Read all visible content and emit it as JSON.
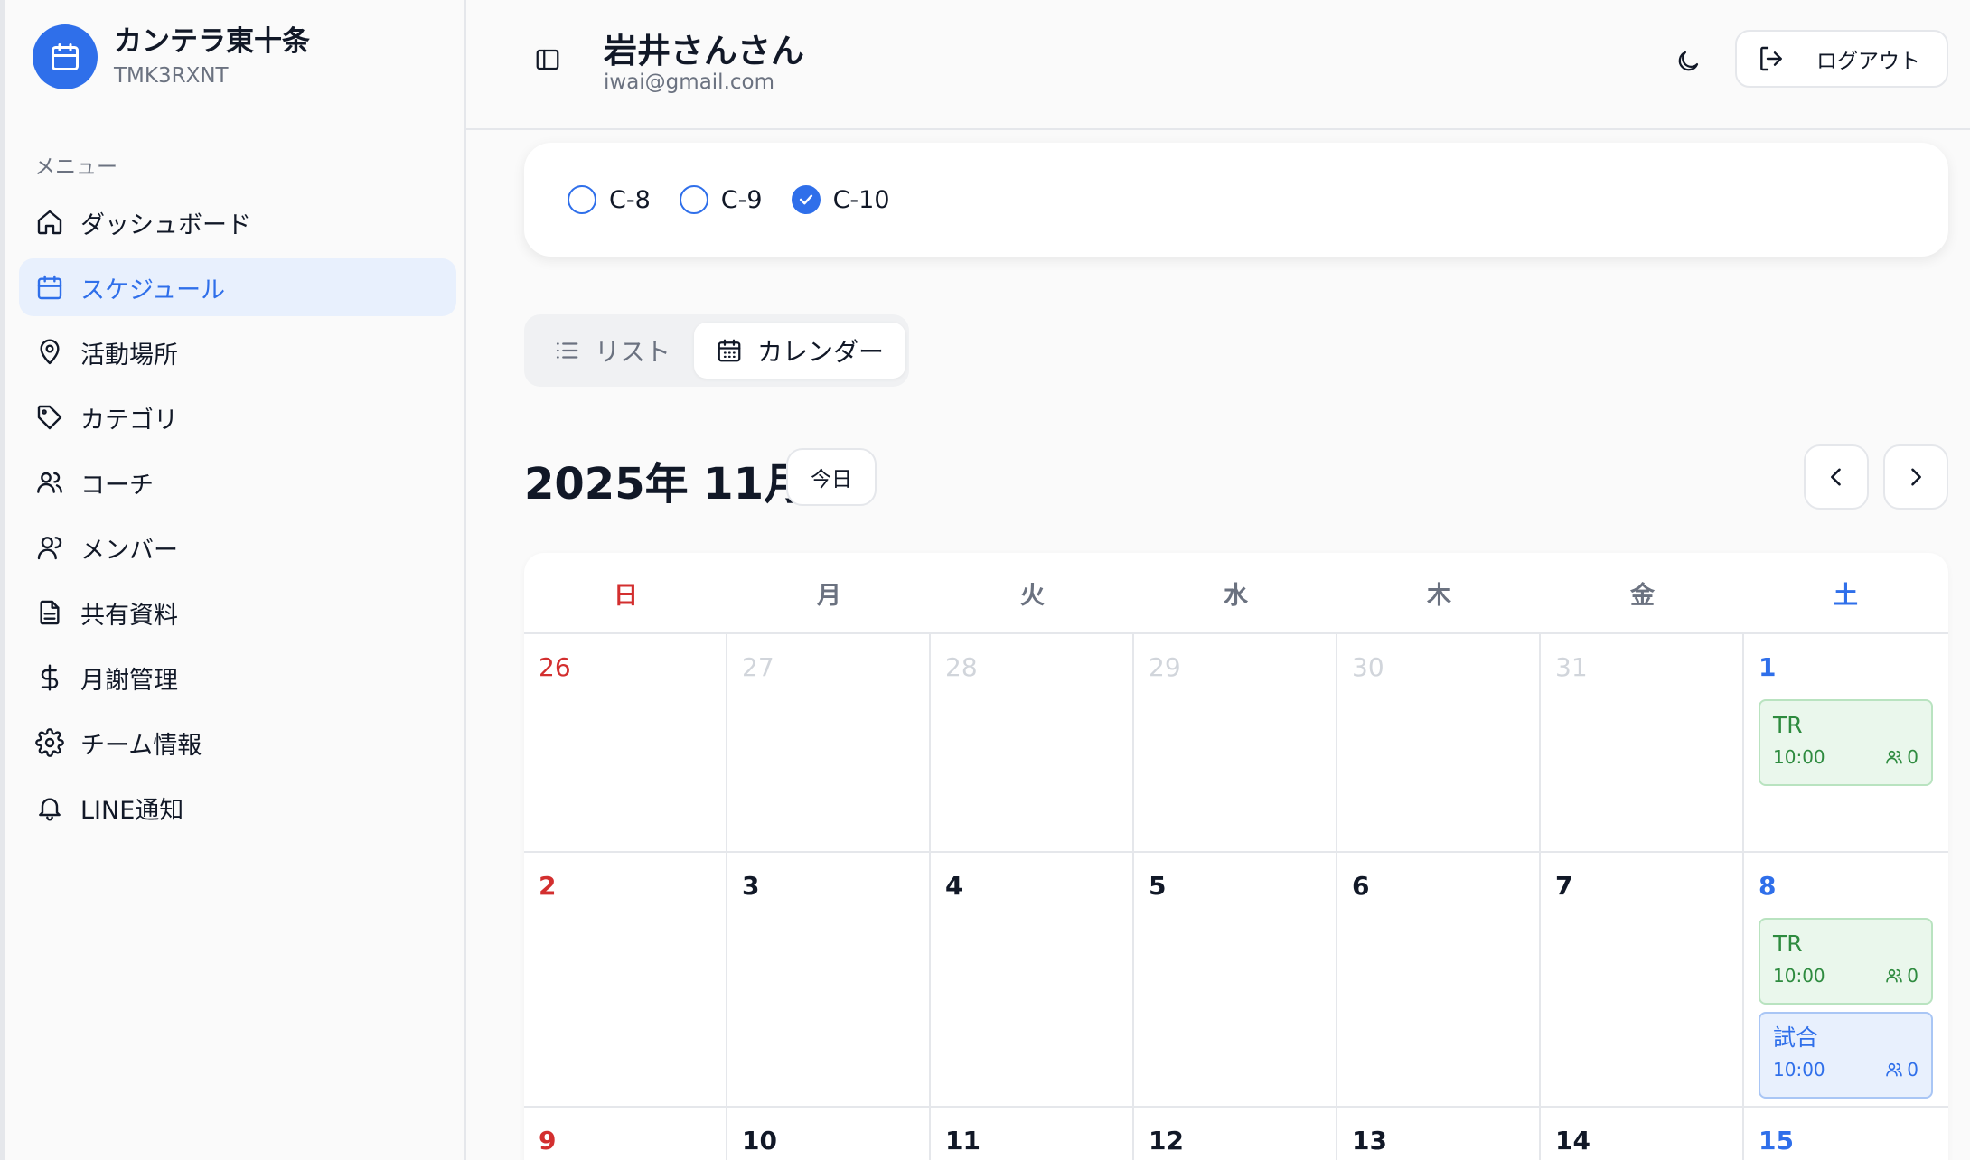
{
  "brand": {
    "name": "カンテラ東十条",
    "code": "TMK3RXNT"
  },
  "sidebar": {
    "menu_label": "メニュー",
    "items": [
      {
        "label": "ダッシュボード",
        "icon": "home-icon"
      },
      {
        "label": "スケジュール",
        "icon": "calendar-icon",
        "active": true
      },
      {
        "label": "活動場所",
        "icon": "map-pin-icon"
      },
      {
        "label": "カテゴリ",
        "icon": "tag-icon"
      },
      {
        "label": "コーチ",
        "icon": "users-icon"
      },
      {
        "label": "メンバー",
        "icon": "user-icon"
      },
      {
        "label": "共有資料",
        "icon": "file-icon"
      },
      {
        "label": "月謝管理",
        "icon": "dollar-icon"
      },
      {
        "label": "チーム情報",
        "icon": "gear-icon"
      },
      {
        "label": "LINE通知",
        "icon": "bell-icon"
      }
    ]
  },
  "header": {
    "user_name": "岩井さんさん",
    "user_email": "iwai@gmail.com",
    "logout_label": "ログアウト"
  },
  "teams": [
    {
      "label": "C-8",
      "checked": false
    },
    {
      "label": "C-9",
      "checked": false
    },
    {
      "label": "C-10",
      "checked": true
    }
  ],
  "view_toggle": {
    "list_label": "リスト",
    "calendar_label": "カレンダー",
    "active": "calendar"
  },
  "calendar": {
    "month_title": "2025年 11月",
    "today_label": "今日",
    "weekdays": [
      "日",
      "月",
      "火",
      "水",
      "木",
      "金",
      "土"
    ],
    "weeks": [
      [
        {
          "day": "26",
          "out": true
        },
        {
          "day": "27",
          "out": true
        },
        {
          "day": "28",
          "out": true
        },
        {
          "day": "29",
          "out": true
        },
        {
          "day": "30",
          "out": true
        },
        {
          "day": "31",
          "out": true
        },
        {
          "day": "1",
          "events": [
            {
              "title": "TR",
              "time": "10:00",
              "count": "0",
              "kind": "tr"
            }
          ]
        }
      ],
      [
        {
          "day": "2"
        },
        {
          "day": "3"
        },
        {
          "day": "4"
        },
        {
          "day": "5"
        },
        {
          "day": "6"
        },
        {
          "day": "7"
        },
        {
          "day": "8",
          "events": [
            {
              "title": "TR",
              "time": "10:00",
              "count": "0",
              "kind": "tr"
            },
            {
              "title": "試合",
              "time": "10:00",
              "count": "0",
              "kind": "game"
            }
          ]
        }
      ],
      [
        {
          "day": "9"
        },
        {
          "day": "10"
        },
        {
          "day": "11"
        },
        {
          "day": "12"
        },
        {
          "day": "13"
        },
        {
          "day": "14"
        },
        {
          "day": "15"
        }
      ]
    ]
  },
  "colors": {
    "accent": "#2f6fea",
    "sunday": "#d32f2f",
    "event_tr": "#2e8b3f"
  }
}
